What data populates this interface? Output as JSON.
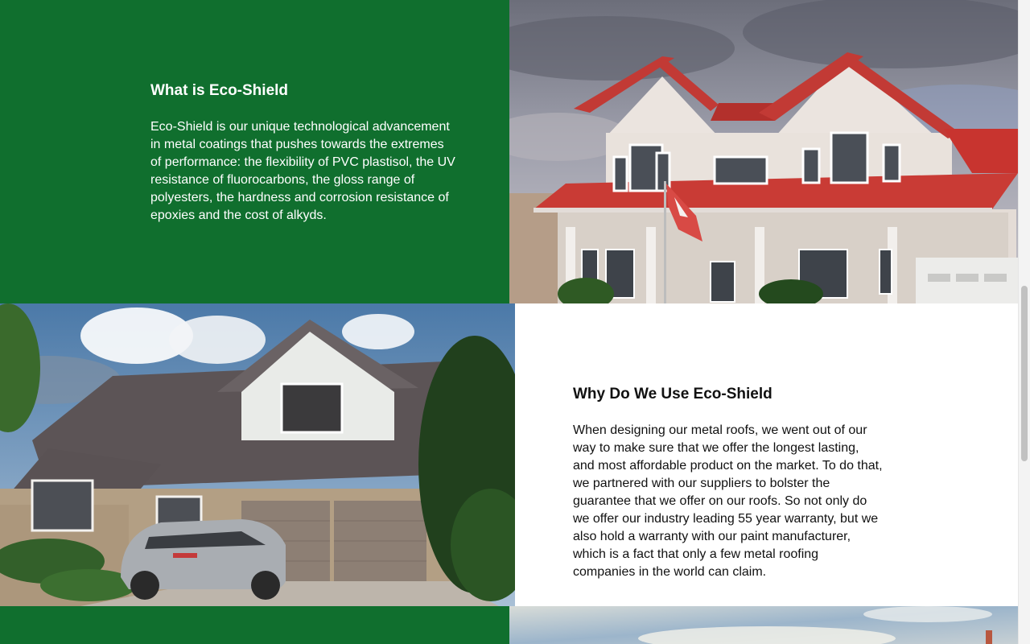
{
  "section1": {
    "heading": "What is Eco-Shield",
    "body": "Eco-Shield is our unique technological advancement in metal coatings that pushes towards the extremes of performance: the flexibility of PVC plastisol, the UV resistance of fluorocarbons, the gloss range of polyesters, the hardness and corrosion resistance of epoxies and the cost of alkyds.",
    "image": "house-red-metal-roof-photo"
  },
  "section2": {
    "heading": "Why Do We Use Eco-Shield",
    "body": "When designing our metal roofs, we went out of our way to make sure that we offer the longest lasting, and most affordable product on the market. To do that, we partnered with our suppliers to bolster the guarantee that we offer on our roofs. So not only do we offer our industry leading 55 year warranty, but we also hold a warranty with our paint manufacturer, which is a fact that only a few metal roofing companies in the world can claim.",
    "image": "house-brown-metal-roof-photo"
  },
  "section3": {
    "image": "sky-photo"
  },
  "colors": {
    "brand_green": "#106f2e",
    "white": "#ffffff",
    "text_dark": "#111111"
  }
}
